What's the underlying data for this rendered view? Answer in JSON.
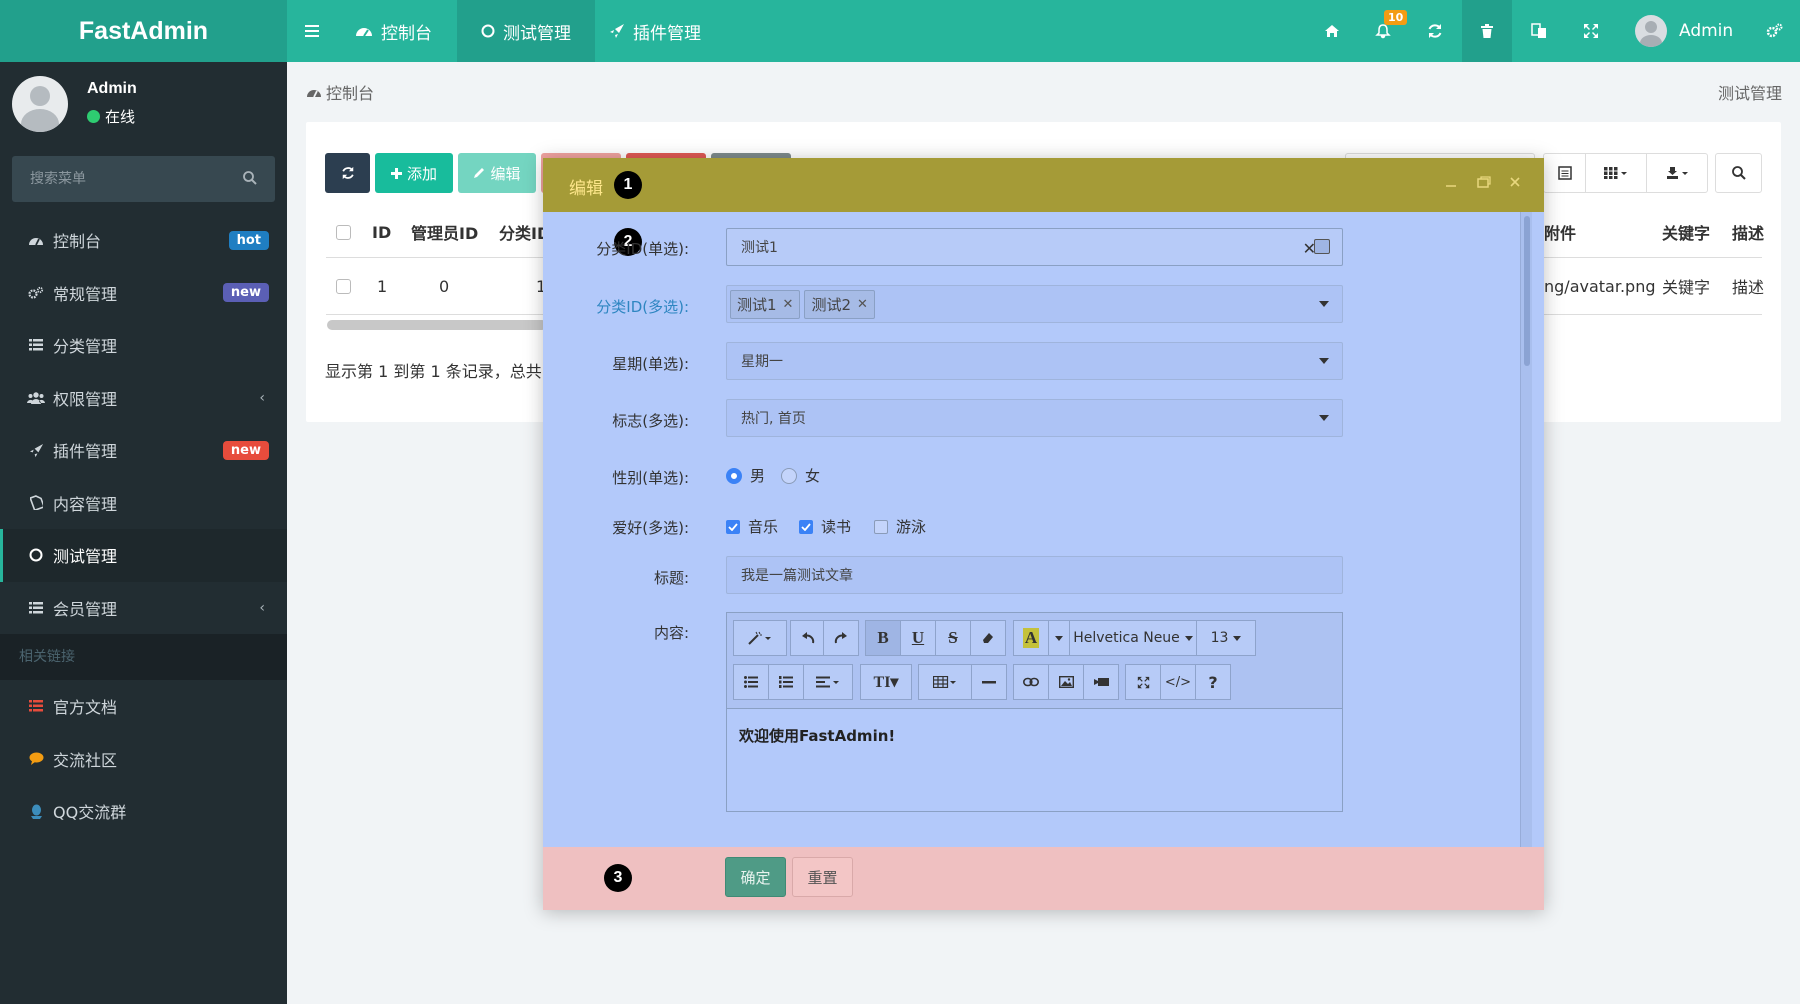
{
  "app": {
    "logo": "FastAdmin"
  },
  "topnav": {
    "toggle_icon": "bars-icon",
    "items": [
      {
        "label": "控制台",
        "icon": "dashboard-icon"
      },
      {
        "label": "测试管理",
        "icon": "circle-icon"
      },
      {
        "label": "插件管理",
        "icon": "rocket-icon"
      }
    ],
    "notification_count": "10",
    "user_name": "Admin"
  },
  "sidebar": {
    "user_name": "Admin",
    "status": "在线",
    "search_placeholder": "搜索菜单",
    "items": [
      {
        "label": "控制台",
        "icon": "dashboard-icon",
        "badge": "hot",
        "badge_color": "#1f7ec2"
      },
      {
        "label": "常规管理",
        "icon": "cogs-icon",
        "badge": "new",
        "badge_color": "#5b5fb5"
      },
      {
        "label": "分类管理",
        "icon": "list-icon"
      },
      {
        "label": "权限管理",
        "icon": "group-icon",
        "chevron": "‹"
      },
      {
        "label": "插件管理",
        "icon": "rocket-icon",
        "badge": "new",
        "badge_color": "#e74c3c"
      },
      {
        "label": "内容管理",
        "icon": "file-icon"
      },
      {
        "label": "测试管理",
        "icon": "circle-icon",
        "active": true
      },
      {
        "label": "会员管理",
        "icon": "list-icon",
        "chevron": "‹"
      }
    ],
    "section_header": "相关链接",
    "links": [
      {
        "label": "官方文档",
        "icon": "list-icon",
        "color": "#e74c3c"
      },
      {
        "label": "交流社区",
        "icon": "comment-icon",
        "color": "#f39c12"
      },
      {
        "label": "QQ交流群",
        "icon": "qq-icon",
        "color": "#3c8dbc"
      }
    ]
  },
  "content": {
    "breadcrumb": "控制台",
    "breadcrumb_right": "测试管理",
    "toolbar": {
      "add_label": "添加",
      "edit_label": "编辑"
    },
    "table": {
      "headers": [
        "ID",
        "管理员ID",
        "分类ID",
        "附件",
        "关键字",
        "描述"
      ],
      "row": [
        "1",
        "0",
        "1",
        "ng/avatar.png",
        "关键字",
        "描述"
      ]
    },
    "pagination_text": "显示第 1 到第 1 条记录，总共"
  },
  "dialog": {
    "title": "编辑",
    "markers": [
      "1",
      "2",
      "3"
    ],
    "fields": {
      "category_single_label": "分类ID(单选):",
      "category_single_value": "测试1",
      "category_multi_label": "分类ID(多选):",
      "category_multi_tags": [
        "测试1",
        "测试2"
      ],
      "week_label": "星期(单选):",
      "week_value": "星期一",
      "flag_label": "标志(多选):",
      "flag_value": "热门, 首页",
      "gender_label": "性别(单选):",
      "gender_options": [
        "男",
        "女"
      ],
      "hobby_label": "爱好(多选):",
      "hobby_options": [
        "音乐",
        "读书",
        "游泳"
      ],
      "title_label": "标题:",
      "title_value": "我是一篇测试文章",
      "content_label": "内容:",
      "content_value": "欢迎使用FastAdmin!"
    },
    "editor_toolbar": {
      "font_name": "Helvetica Neue",
      "font_size": "13"
    },
    "buttons": {
      "confirm": "确定",
      "reset": "重置"
    },
    "colors": {
      "title_bg": "#a59b37",
      "body_bg": "#b3c9fa",
      "footer_bg": "#efc0c1"
    }
  }
}
